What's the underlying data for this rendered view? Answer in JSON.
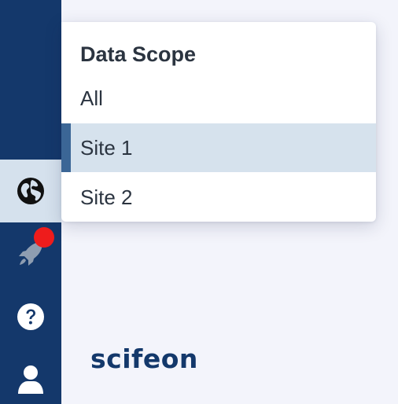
{
  "sidebar": {
    "items": [
      {
        "name": "globe",
        "icon": "globe-icon",
        "active": true
      },
      {
        "name": "rocket",
        "icon": "rocket-icon",
        "active": false,
        "has_notification": true
      },
      {
        "name": "help",
        "icon": "question-circle-icon",
        "active": false
      },
      {
        "name": "user",
        "icon": "user-icon",
        "active": false
      }
    ]
  },
  "dropdown": {
    "title": "Data Scope",
    "options": [
      {
        "label": "All",
        "selected": false
      },
      {
        "label": "Site 1",
        "selected": true
      },
      {
        "label": "Site 2",
        "selected": false
      }
    ]
  },
  "logo": {
    "text": "scifeon"
  },
  "colors": {
    "sidebar_bg": "#14386b",
    "active_bg": "#d5e1ed",
    "selected_bg": "#d6e2ed",
    "selected_bar": "#3b6696",
    "notification": "#ee1c1c",
    "page_bg": "#f3f4fb"
  }
}
